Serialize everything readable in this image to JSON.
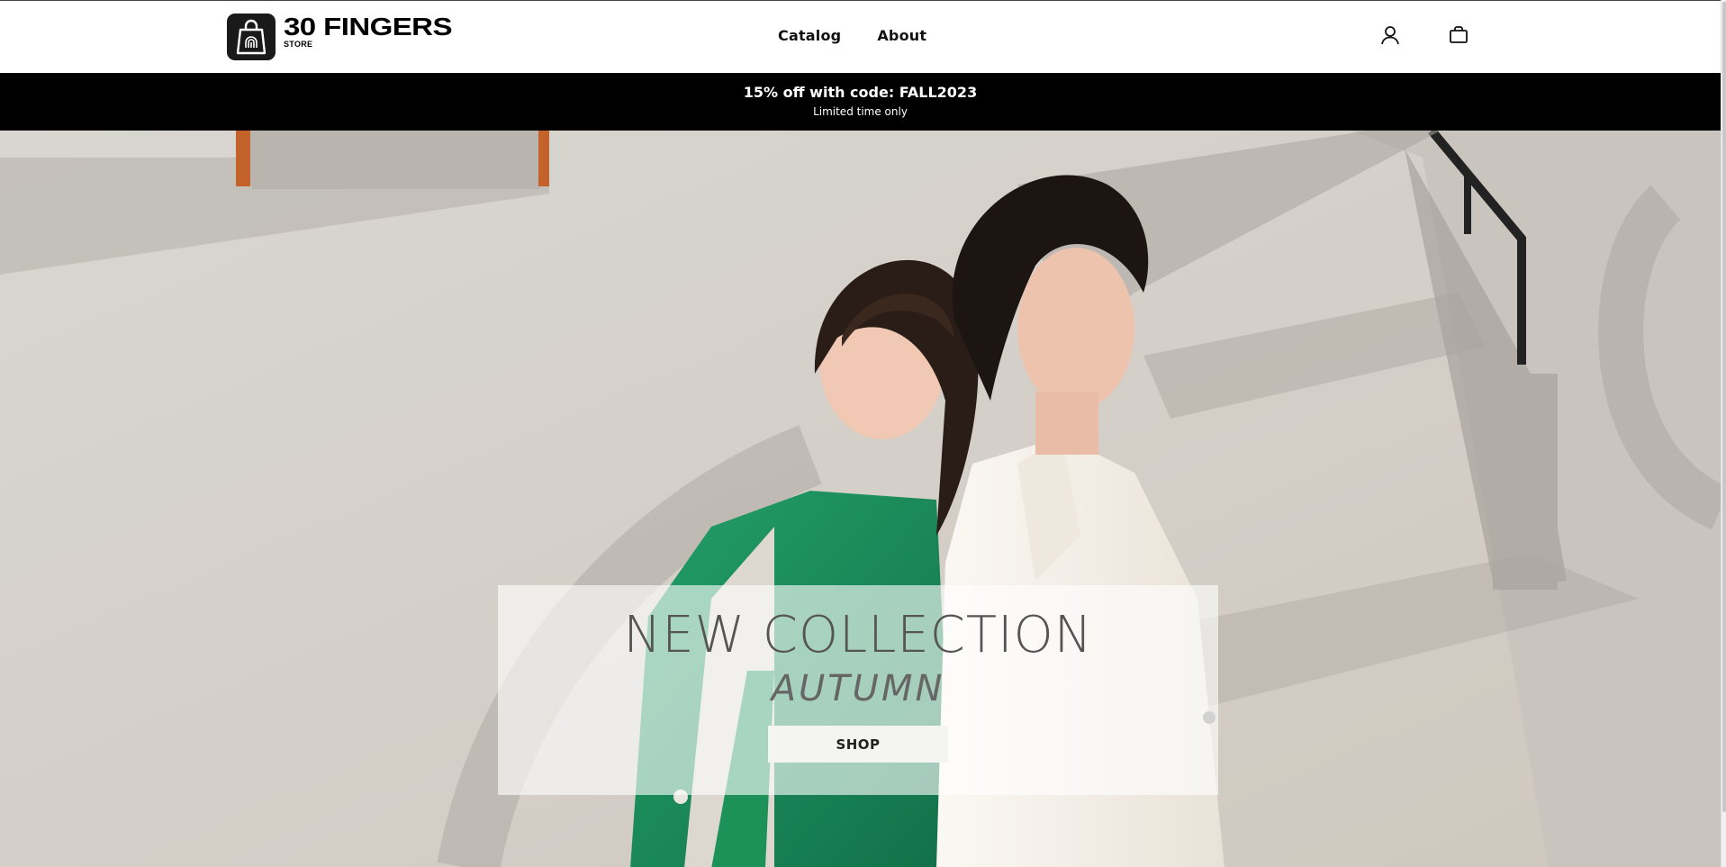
{
  "header": {
    "logo": {
      "title": "30 FINGERS",
      "subtitle": "STORE"
    },
    "nav": [
      {
        "label": "Catalog"
      },
      {
        "label": "About"
      }
    ],
    "icons": [
      "user-icon",
      "shopping-bag-icon"
    ]
  },
  "announcement": {
    "headline": "15% off with code: FALL2023",
    "subline": "Limited time only"
  },
  "hero": {
    "title": "NEW COLLECTION",
    "subtitle": "AUTUMN",
    "cta_label": "SHOP"
  },
  "colors": {
    "announcement_bg": "#000000",
    "card_overlay": "#ffffff",
    "jacket_green": "#1b8a57",
    "jacket_cream": "#f3eee7"
  }
}
